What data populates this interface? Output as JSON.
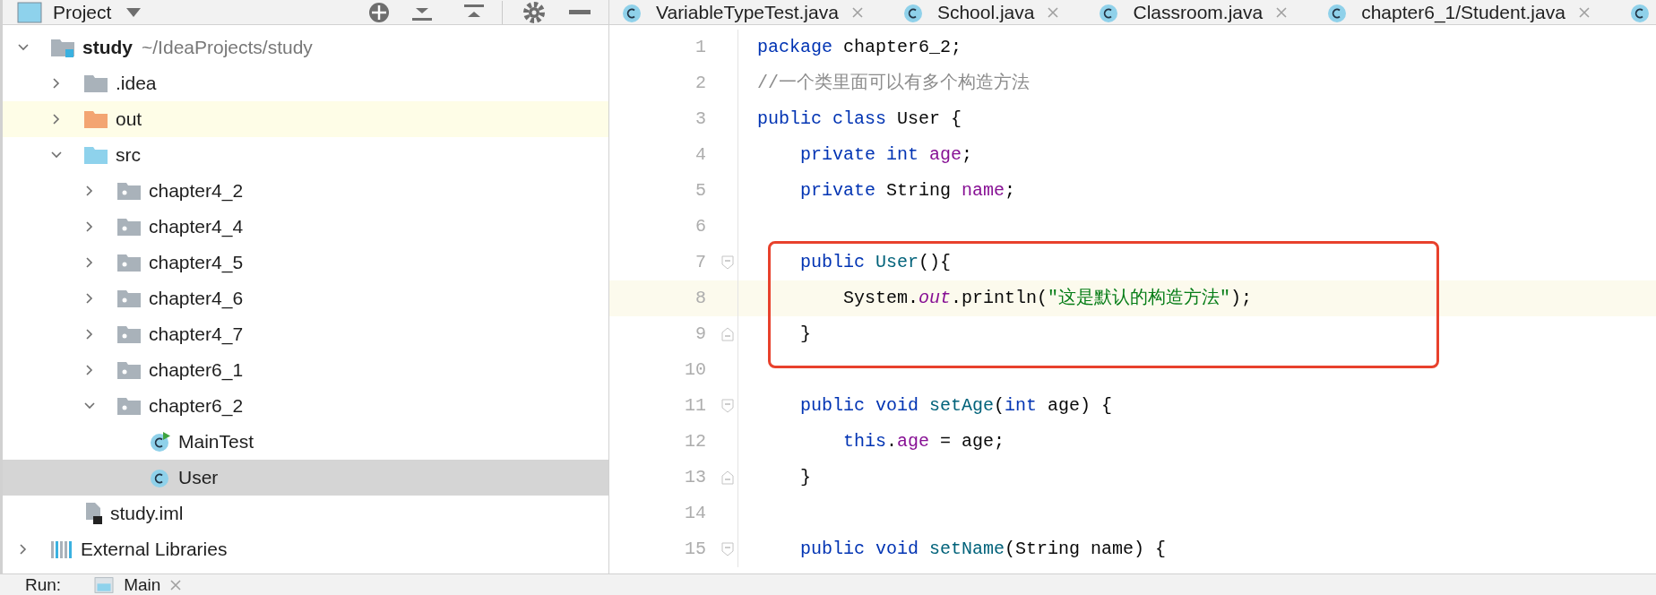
{
  "project_panel": {
    "title": "Project"
  },
  "tree": [
    {
      "kind": "project",
      "name": "study",
      "path": "~/IdeaProjects/study",
      "expanded": true,
      "selected": false,
      "children": [
        {
          "kind": "folder",
          "name": ".idea",
          "expanded": false,
          "selected": false
        },
        {
          "kind": "excluded-folder",
          "name": "out",
          "expanded": false,
          "selected": false
        },
        {
          "kind": "source-folder",
          "name": "src",
          "expanded": true,
          "selected": false,
          "children": [
            {
              "kind": "package",
              "name": "chapter4_2",
              "expanded": false,
              "selected": false
            },
            {
              "kind": "package",
              "name": "chapter4_4",
              "expanded": false,
              "selected": false
            },
            {
              "kind": "package",
              "name": "chapter4_5",
              "expanded": false,
              "selected": false
            },
            {
              "kind": "package",
              "name": "chapter4_6",
              "expanded": false,
              "selected": false
            },
            {
              "kind": "package",
              "name": "chapter4_7",
              "expanded": false,
              "selected": false
            },
            {
              "kind": "package",
              "name": "chapter6_1",
              "expanded": false,
              "selected": false
            },
            {
              "kind": "package",
              "name": "chapter6_2",
              "expanded": true,
              "selected": false,
              "children": [
                {
                  "kind": "runnable-class",
                  "name": "MainTest",
                  "selected": false
                },
                {
                  "kind": "class",
                  "name": "User",
                  "selected": true
                }
              ]
            }
          ]
        },
        {
          "kind": "module-file",
          "name": "study.iml",
          "selected": false
        }
      ]
    },
    {
      "kind": "libraries",
      "name": "External Libraries",
      "expanded": false,
      "selected": false
    }
  ],
  "editor_tabs": [
    {
      "title": "VariableTypeTest.java",
      "selected": false
    },
    {
      "title": "School.java",
      "selected": false
    },
    {
      "title": "Classroom.java",
      "selected": false
    },
    {
      "title": "chapter6_1/Student.java",
      "selected": false
    }
  ],
  "code_lines": [
    {
      "number": "1",
      "tokens": [
        {
          "kind": "keyword",
          "text": "package"
        },
        {
          "kind": "plain",
          "text": " chapter6_2;"
        }
      ]
    },
    {
      "number": "2",
      "tokens": [
        {
          "kind": "comment",
          "text": "//一个类里面可以有多个构造方法"
        }
      ]
    },
    {
      "number": "3",
      "tokens": [
        {
          "kind": "keyword",
          "text": "public class"
        },
        {
          "kind": "plain",
          "text": " User {"
        }
      ],
      "children": [
        {
          "number": "4",
          "tokens": [
            {
              "kind": "keyword",
              "text": "private int "
            },
            {
              "kind": "field",
              "text": "age"
            },
            {
              "kind": "plain",
              "text": ";"
            }
          ]
        },
        {
          "number": "5",
          "tokens": [
            {
              "kind": "keyword",
              "text": "private"
            },
            {
              "kind": "plain",
              "text": " String "
            },
            {
              "kind": "field",
              "text": "name"
            },
            {
              "kind": "plain",
              "text": ";"
            }
          ]
        },
        {
          "number": "6"
        },
        {
          "number": "7",
          "fold_start": true,
          "boxed": true,
          "tokens": [
            {
              "kind": "keyword",
              "text": "public "
            },
            {
              "kind": "method",
              "text": "User"
            },
            {
              "kind": "plain",
              "text": "(){"
            }
          ],
          "children": [
            {
              "number": "8",
              "current": true,
              "boxed": true,
              "tokens": [
                {
                  "kind": "plain",
                  "text": "System."
                },
                {
                  "kind": "static-field",
                  "text": "out"
                },
                {
                  "kind": "plain",
                  "text": ".println("
                },
                {
                  "kind": "string",
                  "text": "\"这是默认的构造方法\""
                },
                {
                  "kind": "plain",
                  "text": ");"
                }
              ]
            }
          ]
        },
        {
          "number": "9",
          "fold_end": true,
          "boxed": true,
          "tokens": [
            {
              "kind": "plain",
              "text": "}"
            }
          ]
        },
        {
          "number": "10"
        },
        {
          "number": "11",
          "fold_start": true,
          "tokens": [
            {
              "kind": "keyword",
              "text": "public void "
            },
            {
              "kind": "method",
              "text": "setAge"
            },
            {
              "kind": "plain",
              "text": "("
            },
            {
              "kind": "keyword",
              "text": "int"
            },
            {
              "kind": "plain",
              "text": " age) {"
            }
          ],
          "children": [
            {
              "number": "12",
              "tokens": [
                {
                  "kind": "keyword",
                  "text": "this"
                },
                {
                  "kind": "plain",
                  "text": "."
                },
                {
                  "kind": "field",
                  "text": "age"
                },
                {
                  "kind": "plain",
                  "text": " = age;"
                }
              ]
            }
          ]
        },
        {
          "number": "13",
          "fold_end": true,
          "tokens": [
            {
              "kind": "plain",
              "text": "}"
            }
          ]
        },
        {
          "number": "14"
        },
        {
          "number": "15",
          "fold_start": true,
          "tokens": [
            {
              "kind": "keyword",
              "text": "public void "
            },
            {
              "kind": "method",
              "text": "setName"
            },
            {
              "kind": "plain",
              "text": "(String name) {"
            }
          ]
        }
      ]
    }
  ],
  "run_bar": {
    "label": "Run:",
    "tab": "Main"
  }
}
